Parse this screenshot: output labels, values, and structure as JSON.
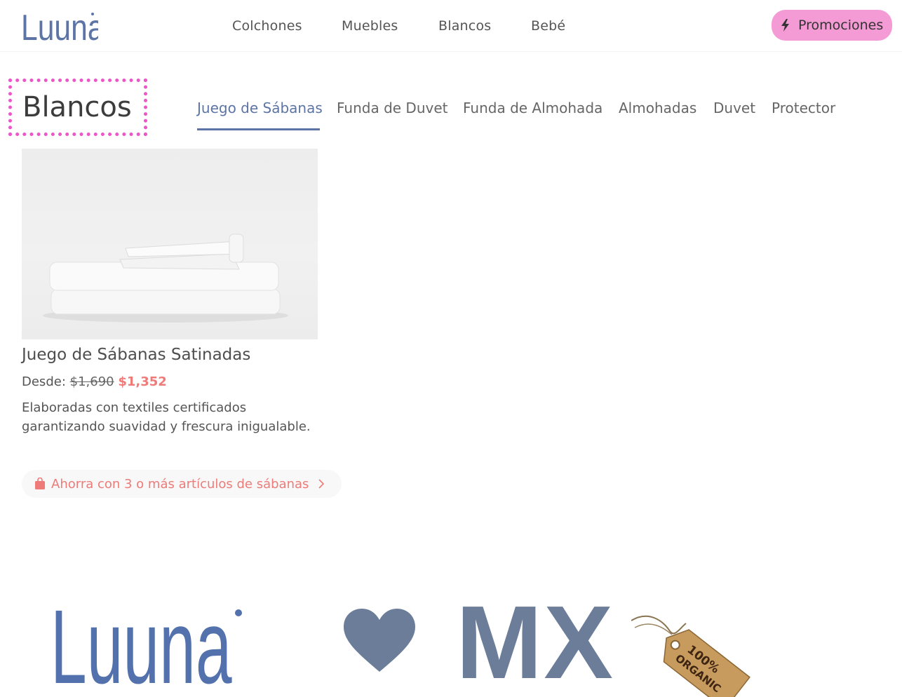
{
  "header": {
    "logo_text": "Luuna",
    "nav": [
      "Colchones",
      "Muebles",
      "Blancos",
      "Bebé"
    ],
    "promo_label": "Promociones"
  },
  "section": {
    "title": "Blancos",
    "tabs": [
      "Juego de Sábanas",
      "Funda de Duvet",
      "Funda de Almohada",
      "Almohadas",
      "Duvet",
      "Protector"
    ],
    "active_tab": "Juego de Sábanas"
  },
  "product": {
    "name": "Juego de Sábanas Satinadas",
    "price_prefix": "Desde:",
    "old_price": "$1,690",
    "new_price": "$1,352",
    "description": "Elaboradas con textiles certificados garantizando suavidad y frescura inigualable."
  },
  "savings": {
    "label": "Ahorra con 3 o más artículos de sábanas"
  },
  "banner": {
    "logo_text": "Luuna",
    "country": "MX",
    "tag_text_line1": "100%",
    "tag_text_line2": "ORGANIC"
  },
  "colors": {
    "brand_blue": "#5d74a6",
    "promo_pink": "#f49ad5",
    "sale_red": "#ee7b78",
    "highlight_magenta": "#ec56c8"
  },
  "icons": {
    "promo": "lightning-icon",
    "savings": "shopping-bag-icon",
    "savings_arrow": "chevron-right-icon",
    "banner": "heart-icon"
  }
}
